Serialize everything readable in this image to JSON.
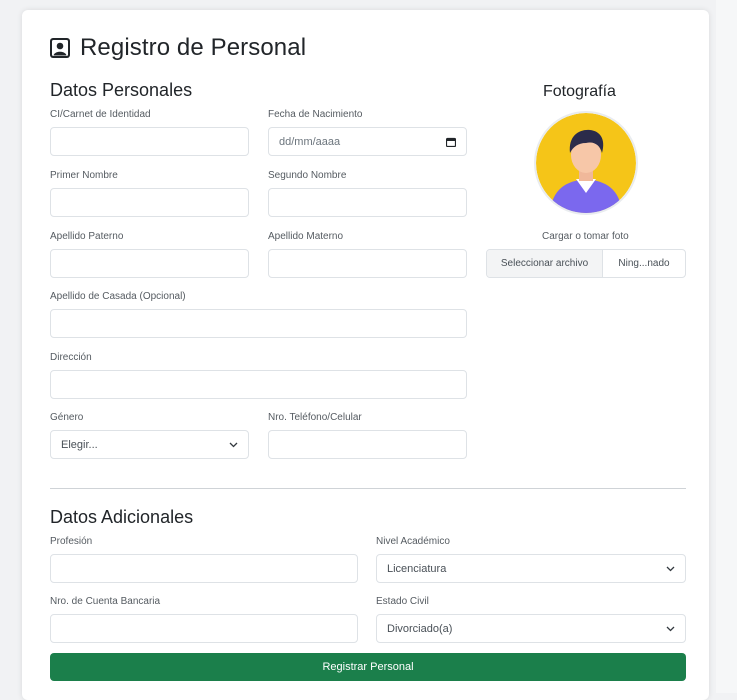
{
  "header": {
    "title": "Registro de Personal",
    "icon": "person-badge-icon"
  },
  "personal": {
    "section_title": "Datos Personales",
    "ci": {
      "label": "CI/Carnet de Identidad",
      "value": ""
    },
    "birth": {
      "label": "Fecha de Nacimiento",
      "placeholder": "dd/mm/aaaa"
    },
    "first_name": {
      "label": "Primer Nombre",
      "value": ""
    },
    "second_name": {
      "label": "Segundo Nombre",
      "value": ""
    },
    "paternal": {
      "label": "Apellido Paterno",
      "value": ""
    },
    "maternal": {
      "label": "Apellido Materno",
      "value": ""
    },
    "married": {
      "label": "Apellido de Casada (Opcional)",
      "value": ""
    },
    "address": {
      "label": "Dirección",
      "value": ""
    },
    "gender": {
      "label": "Género",
      "selected": "Elegir..."
    },
    "phone": {
      "label": "Nro. Teléfono/Celular",
      "value": ""
    }
  },
  "photo": {
    "title": "Fotografía",
    "upload_label": "Cargar o tomar foto",
    "file_button": "Seleccionar archivo",
    "file_name": "Ning...nado"
  },
  "additional": {
    "section_title": "Datos Adicionales",
    "profession": {
      "label": "Profesión",
      "value": ""
    },
    "academic": {
      "label": "Nivel Académico",
      "selected": "Licenciatura"
    },
    "bank": {
      "label": "Nro. de Cuenta Bancaria",
      "value": ""
    },
    "civil": {
      "label": "Estado Civil",
      "selected": "Divorciado(a)"
    }
  },
  "actions": {
    "submit": "Registrar Personal"
  },
  "colors": {
    "primary": "#1b7f4b",
    "border": "#dee2e6",
    "avatar_bg": "#f5c518",
    "shirt": "#7b68ee"
  }
}
